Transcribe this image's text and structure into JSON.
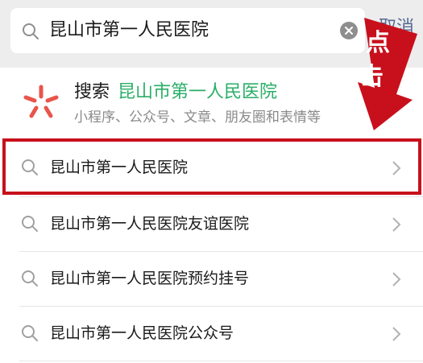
{
  "search": {
    "query": "昆山市第一人民医院",
    "cancel_label": "取消"
  },
  "suggestion": {
    "keyword": "搜索",
    "highlight": "昆山市第一人民医院",
    "subtitle": "小程序、公众号、文章、朋友圈和表情等"
  },
  "results": [
    {
      "label": "昆山市第一人民医院"
    },
    {
      "label": "昆山市第一人民医院友谊医院"
    },
    {
      "label": "昆山市第一人民医院预约挂号"
    },
    {
      "label": "昆山市第一人民医院公众号"
    }
  ],
  "annotation": {
    "text_1": "点",
    "text_2": "击",
    "color": "#c8101c"
  },
  "colors": {
    "accent": "#2aae67",
    "link": "#576b95",
    "highlight_border": "#c8101c"
  },
  "icons": [
    "search-icon",
    "clear-icon",
    "wechat-search-logo-icon",
    "chevron-right-icon",
    "arrow-down-icon"
  ]
}
